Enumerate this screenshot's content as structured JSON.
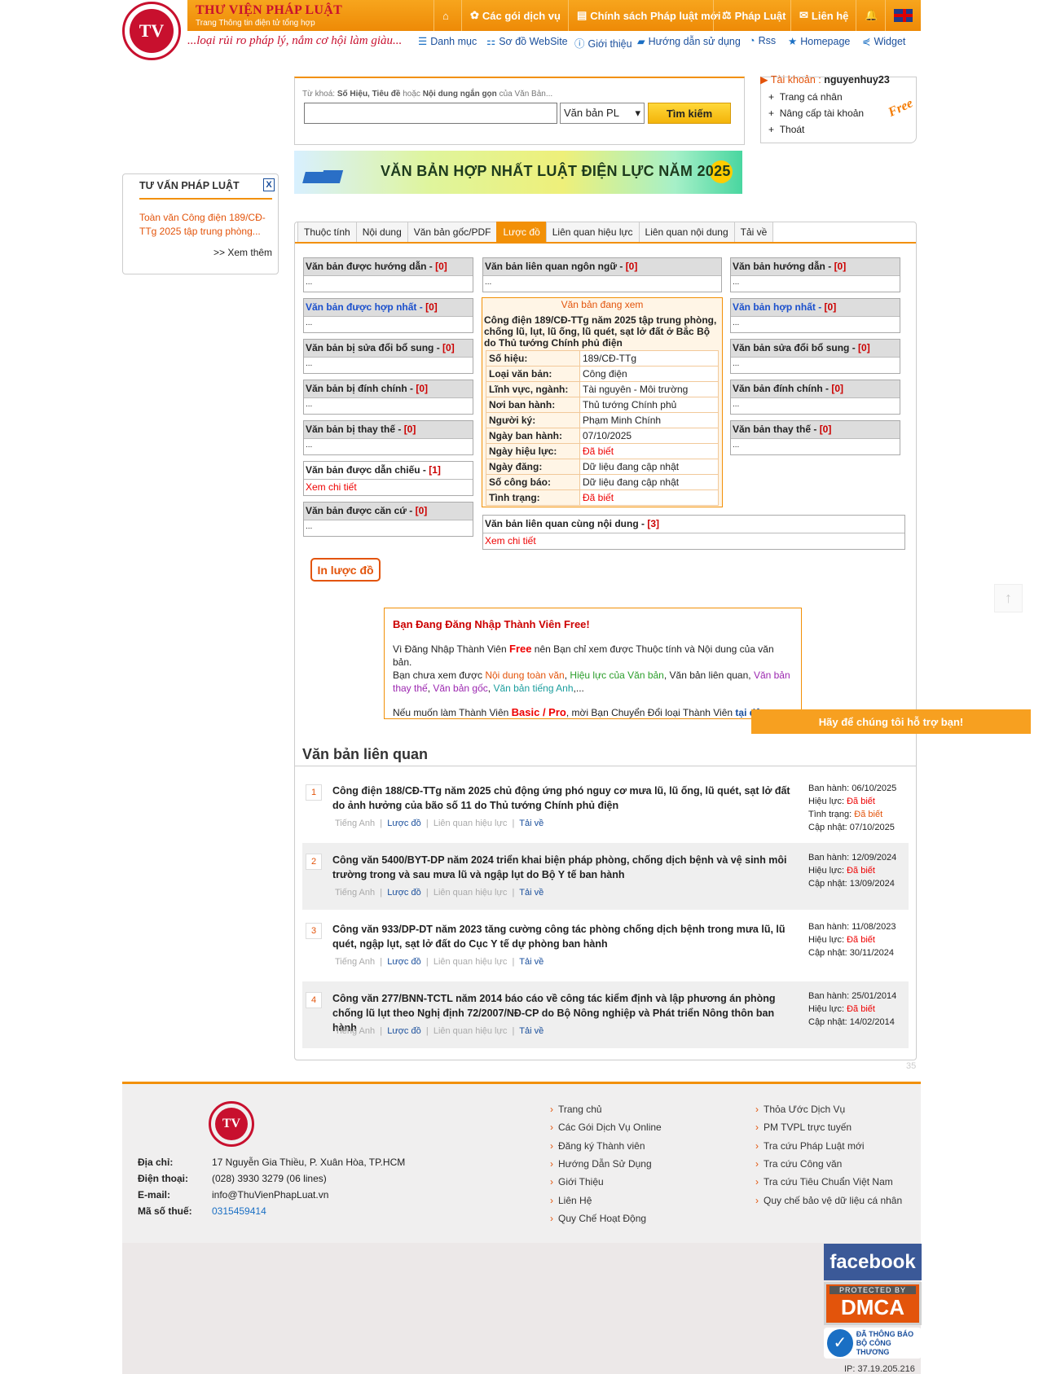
{
  "header": {
    "brand": "THƯ VIỆN PHÁP LUẬT",
    "brand_sub": "Trang Thông tin điện tử tổng hợp",
    "slogan": "...loại rủi ro pháp lý, nắm cơ hội làm giàu...",
    "nav_main": [
      {
        "icon": "home-icon",
        "label": ""
      },
      {
        "icon": "gift-icon",
        "label": "Các gói dịch vụ"
      },
      {
        "icon": "newspaper-icon",
        "label": "Chính sách Pháp luật mới"
      },
      {
        "icon": "gavel-icon",
        "label": "Pháp Luật"
      },
      {
        "icon": "mail-icon",
        "label": "Liên hệ"
      },
      {
        "icon": "bell-icon",
        "label": ""
      },
      {
        "icon": "uk-flag-icon",
        "label": ""
      }
    ],
    "nav_sub": [
      "Danh mục",
      "Sơ đồ WebSite",
      "Giới thiệu",
      "Hướng dẫn sử dụng",
      "Rss",
      "Homepage",
      "Widget"
    ]
  },
  "search": {
    "label_prefix": "Từ khoá:",
    "label_bold1": "Số Hiệu, Tiêu đề",
    "label_mid": "hoặc",
    "label_bold2": "Nội dung ngắn gọn",
    "label_suffix": "của Văn Bản...",
    "value": "",
    "select": "Văn bản PL",
    "button": "Tìm kiếm"
  },
  "account": {
    "label": "Tài khoản :",
    "user": "nguyenhuy23",
    "items": [
      "Trang cá nhân",
      "Nâng cấp tài khoản",
      "Thoát"
    ],
    "badge": "Free"
  },
  "banner": {
    "text": "VĂN BẢN HỢP NHẤT LUẬT ĐIỆN LỰC NĂM 2025"
  },
  "left": {
    "title": "TƯ VẤN PHÁP LUẬT",
    "close": "X",
    "link": "Toàn văn Công điện 189/CĐ-TTg 2025 tập trung phòng...",
    "more": ">> Xem thêm"
  },
  "tabs": [
    "Thuộc tính",
    "Nội dung",
    "Văn bản gốc/PDF",
    "Lược đồ",
    "Liên quan hiệu lực",
    "Liên quan nội dung",
    "Tải về"
  ],
  "boxes_left": [
    {
      "title": "Văn bản được hướng dẫn - ",
      "n": "[0]",
      "body": "..."
    },
    {
      "title": "Văn bản được hợp nhất - ",
      "n": "[0]",
      "body": "..."
    },
    {
      "title": "Văn bản bị sửa đổi bổ sung - ",
      "n": "[0]",
      "body": "..."
    },
    {
      "title": "Văn bản bị đính chính - ",
      "n": "[0]",
      "body": "..."
    },
    {
      "title": "Văn bản bị thay thế - ",
      "n": "[0]",
      "body": "..."
    },
    {
      "title": "Văn bản được dẫn chiếu - ",
      "n": "[1]",
      "body": "Xem chi tiết"
    },
    {
      "title": "Văn bản được căn cứ - ",
      "n": "[0]",
      "body": "..."
    }
  ],
  "boxes_right": [
    {
      "title": "Văn bản hướng dẫn - ",
      "n": "[0]",
      "body": "..."
    },
    {
      "title": "Văn bản hợp nhất - ",
      "n": "[0]",
      "body": "..."
    },
    {
      "title": "Văn bản sửa đổi bổ sung - ",
      "n": "[0]",
      "body": "..."
    },
    {
      "title": "Văn bản đính chính - ",
      "n": "[0]",
      "body": "..."
    },
    {
      "title": "Văn bản thay thế - ",
      "n": "[0]",
      "body": "..."
    }
  ],
  "box_lang": {
    "title": "Văn bản liên quan ngôn ngữ - ",
    "n": "[0]",
    "body": "..."
  },
  "box_same": {
    "title": "Văn bản liên quan cùng nội dung - ",
    "n": "[3]",
    "body": "Xem chi tiết"
  },
  "doc": {
    "heading": "Văn bản đang xem",
    "name": "Công điện 189/CĐ-TTg năm 2025 tập trung phòng, chống lũ, lụt, lũ ống, lũ quét, sạt lở đất ở Bắc Bộ do Thủ tướng Chính phủ điện",
    "fields": [
      [
        "Số hiệu:",
        "189/CĐ-TTg"
      ],
      [
        "Loại văn bản:",
        "Công điện"
      ],
      [
        "Lĩnh vực, ngành:",
        "Tài nguyên - Môi trường"
      ],
      [
        "Nơi ban hành:",
        "Thủ tướng Chính phủ"
      ],
      [
        "Người ký:",
        "Phạm Minh Chính"
      ],
      [
        "Ngày ban hành:",
        "07/10/2025"
      ],
      [
        "Ngày hiệu lực:",
        "Đã biết"
      ],
      [
        "Ngày đăng:",
        "Dữ liệu đang cập nhật"
      ],
      [
        "Số công báo:",
        "Dữ liệu đang cập nhật"
      ],
      [
        "Tình trạng:",
        "Đã biết"
      ]
    ]
  },
  "print_btn": "In lược đồ",
  "notice": {
    "title": "Bạn Đang Đăng Nhập Thành Viên Free!",
    "p1a": "Vì Đăng Nhập Thành Viên ",
    "p1b": "Free",
    "p1c": " nên Bạn chỉ xem được Thuộc tính và Nội dung của văn bản.",
    "p2a": "Bạn chưa xem được ",
    "p2b": "Nội dung toàn văn",
    "p2c": ", ",
    "p2d": "Hiệu lực của Văn bản",
    "p2e": ", Văn bản liên quan, ",
    "p2f": "Văn bản thay thế",
    "p2g": ", ",
    "p2h": "Văn bản gốc",
    "p2i": ", ",
    "p2j": "Văn bản tiếng Anh",
    "p2k": ",...",
    "p3a": "Nếu muốn làm Thành Viên ",
    "p3b": "Basic / Pro",
    "p3c": ", mời Bạn Chuyển Đổi loại Thành Viên ",
    "p3d": "tại đây",
    "p3e": "."
  },
  "help": "Hãy để chúng tôi hỗ trợ bạn!",
  "related_heading": "Văn bản liên quan",
  "related": [
    {
      "num": "1",
      "title": "Công điện 188/CĐ-TTg năm 2025 chủ động ứng phó nguy cơ mưa lũ, lũ ống, lũ quét, sạt lở đất do ảnh hưởng của bão số 11 do Thủ tướng Chính phủ điện",
      "links": [
        "Tiếng Anh",
        "Lược đồ",
        "Liên quan hiệu lực",
        "Tải về"
      ],
      "meta": [
        [
          "Ban hành:",
          "06/10/2025",
          ""
        ],
        [
          "Hiệu lực:",
          "Đã biết",
          "r"
        ],
        [
          "Tình trạng:",
          "Đã biết",
          "o"
        ],
        [
          "Cập nhật:",
          "07/10/2025",
          ""
        ]
      ]
    },
    {
      "num": "2",
      "title": "Công văn 5400/BYT-DP năm 2024 triển khai biện pháp phòng, chống dịch bệnh và vệ sinh môi trường trong và sau mưa lũ và ngập lụt do Bộ Y tế ban hành",
      "links": [
        "Tiếng Anh",
        "Lược đồ",
        "Liên quan hiệu lực",
        "Tải về"
      ],
      "meta": [
        [
          "Ban hành:",
          "12/09/2024",
          ""
        ],
        [
          "Hiệu lực:",
          "Đã biết",
          "r"
        ],
        [
          "Cập nhật:",
          "13/09/2024",
          ""
        ]
      ]
    },
    {
      "num": "3",
      "title": "Công văn 933/DP-DT năm 2023 tăng cường công tác phòng chống dịch bệnh trong mưa lũ, lũ quét, ngập lụt, sạt lở đất do Cục Y tế dự phòng ban hành",
      "links": [
        "Tiếng Anh",
        "Lược đồ",
        "Liên quan hiệu lực",
        "Tải về"
      ],
      "meta": [
        [
          "Ban hành:",
          "11/08/2023",
          ""
        ],
        [
          "Hiệu lực:",
          "Đã biết",
          "r"
        ],
        [
          "Cập nhật:",
          "30/11/2024",
          ""
        ]
      ]
    },
    {
      "num": "4",
      "title": "Công văn 277/BNN-TCTL năm 2014 báo cáo về công tác kiểm định và lập phương án phòng chống lũ lụt theo Nghị định 72/2007/NĐ-CP do Bộ Nông nghiệp và Phát triển Nông thôn ban hành",
      "links": [
        "Tiếng Anh",
        "Lược đồ",
        "Liên quan hiệu lực",
        "Tải về"
      ],
      "meta": [
        [
          "Ban hành:",
          "25/01/2014",
          ""
        ],
        [
          "Hiệu lực:",
          "Đã biết",
          "r"
        ],
        [
          "Cập nhật:",
          "14/02/2014",
          ""
        ]
      ]
    }
  ],
  "page_num": "35",
  "footer": {
    "address_k": "Địa chỉ:",
    "address_v": "17 Nguyễn Gia Thiều, P. Xuân Hòa, TP.HCM",
    "phone_k": "Điện thoại:",
    "phone_v": "(028) 3930 3279 (06 lines)",
    "email_k": "E-mail:",
    "email_v": "info@ThuVienPhapLuat.vn",
    "tax_k": "Mã số thuế:",
    "tax_v": "0315459414",
    "col1": [
      "Trang chủ",
      "Các Gói Dịch Vụ Online",
      "Đăng ký Thành viên",
      "Hướng Dẫn Sử Dụng",
      "Giới Thiệu",
      "Liên Hệ",
      "Quy Chế Hoạt Động"
    ],
    "col2": [
      "Thỏa Ước Dịch Vụ",
      "PM TVPL trực tuyến",
      "Tra cứu Pháp Luật mới",
      "Tra cứu Công văn",
      "Tra cứu Tiêu Chuẩn Việt Nam",
      "Quy chế bảo vệ dữ liệu cá nhân"
    ],
    "facebook": "facebook",
    "dmca_top": "PROTECTED BY",
    "dmca": "DMCA",
    "bct1": "ĐÃ THÔNG BÁO",
    "bct2": "BỘ CÔNG THƯƠNG",
    "ip": "IP: 37.19.205.216"
  }
}
